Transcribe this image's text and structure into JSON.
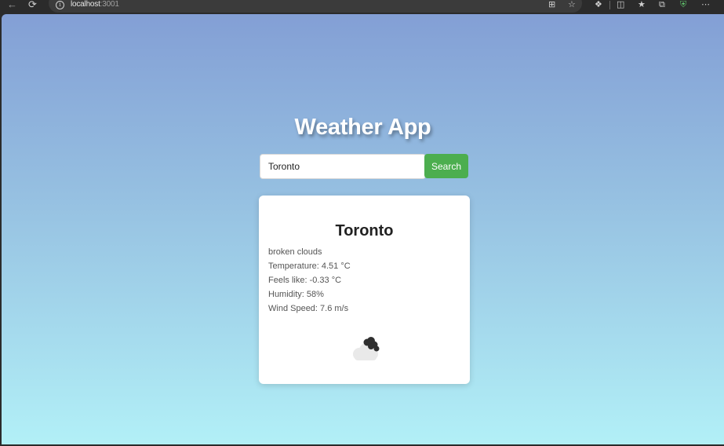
{
  "browser": {
    "url_host": "localhost",
    "url_port": ":3001",
    "icons": [
      "back-icon",
      "reload-icon",
      "info-icon",
      "apps-icon",
      "favorite-star-icon",
      "extensions-icon",
      "split-screen-icon",
      "favorites-icon",
      "collections-icon",
      "browser-essentials-icon",
      "more-icon"
    ]
  },
  "app": {
    "title": "Weather App"
  },
  "search": {
    "value": "Toronto",
    "button_label": "Search"
  },
  "weather": {
    "city": "Toronto",
    "description": "broken clouds",
    "temperature": "Temperature: 4.51 °C",
    "feels_like": "Feels like: -0.33 °C",
    "humidity": "Humidity: 58%",
    "wind_speed": "Wind Speed: 7.6 m/s",
    "icon": "broken-clouds-icon"
  },
  "colors": {
    "accent_button": "#4cae4f",
    "background_top": "#839fd5",
    "background_bottom": "#b2f0f7"
  }
}
